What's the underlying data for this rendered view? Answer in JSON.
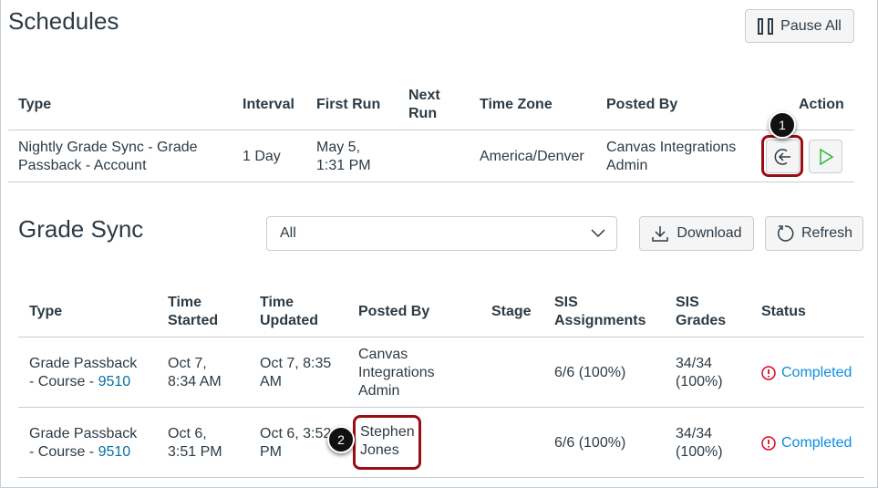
{
  "schedules": {
    "title": "Schedules",
    "pause_all": "Pause All",
    "headers": {
      "type": "Type",
      "interval": "Interval",
      "first_run": "First Run",
      "next_run_1": "Next",
      "next_run_2": "Run",
      "time_zone": "Time Zone",
      "posted_by": "Posted By",
      "action": "Action"
    },
    "row": {
      "type_1": "Nightly Grade Sync - Grade",
      "type_2": "Passback - Account",
      "interval": "1 Day",
      "first_run_1": "May 5,",
      "first_run_2": "1:31 PM",
      "time_zone": "America/Denver",
      "posted_by_1": "Canvas Integrations",
      "posted_by_2": "Admin"
    }
  },
  "grade_sync": {
    "title": "Grade Sync",
    "filter_value": "All",
    "download": "Download",
    "refresh": "Refresh",
    "headers": {
      "type": "Type",
      "time_started_1": "Time",
      "time_started_2": "Started",
      "time_updated_1": "Time",
      "time_updated_2": "Updated",
      "posted_by": "Posted By",
      "stage": "Stage",
      "sis_assign_1": "SIS",
      "sis_assign_2": "Assignments",
      "sis_grades_1": "SIS",
      "sis_grades_2": "Grades",
      "status": "Status"
    },
    "rows": [
      {
        "type_1": "Grade Passback",
        "type_2": "- Course - ",
        "course": "9510",
        "started_1": "Oct 7,",
        "started_2": "8:34 AM",
        "updated_1": "Oct 7, 8:35",
        "updated_2": "AM",
        "posted_1": "Canvas",
        "posted_2": "Integrations",
        "posted_3": "Admin",
        "assignments": "6/6 (100%)",
        "grades_1": "34/34",
        "grades_2": "(100%)",
        "status": "Completed"
      },
      {
        "type_1": "Grade Passback",
        "type_2": "- Course - ",
        "course": "9510",
        "started_1": "Oct 6,",
        "started_2": "3:51 PM",
        "updated_1": "Oct 6, 3:52",
        "updated_2": "PM",
        "posted_1": "Stephen",
        "posted_2": "Jones",
        "assignments": "6/6 (100%)",
        "grades_1": "34/34",
        "grades_2": "(100%)",
        "status": "Completed"
      }
    ]
  },
  "callouts": [
    "1",
    "2"
  ],
  "colors": {
    "highlight": "#9b0d14",
    "link": "#0770a3",
    "status_link": "#0b8fdd",
    "warning": "#e0061f",
    "play": "#2cb83b"
  }
}
